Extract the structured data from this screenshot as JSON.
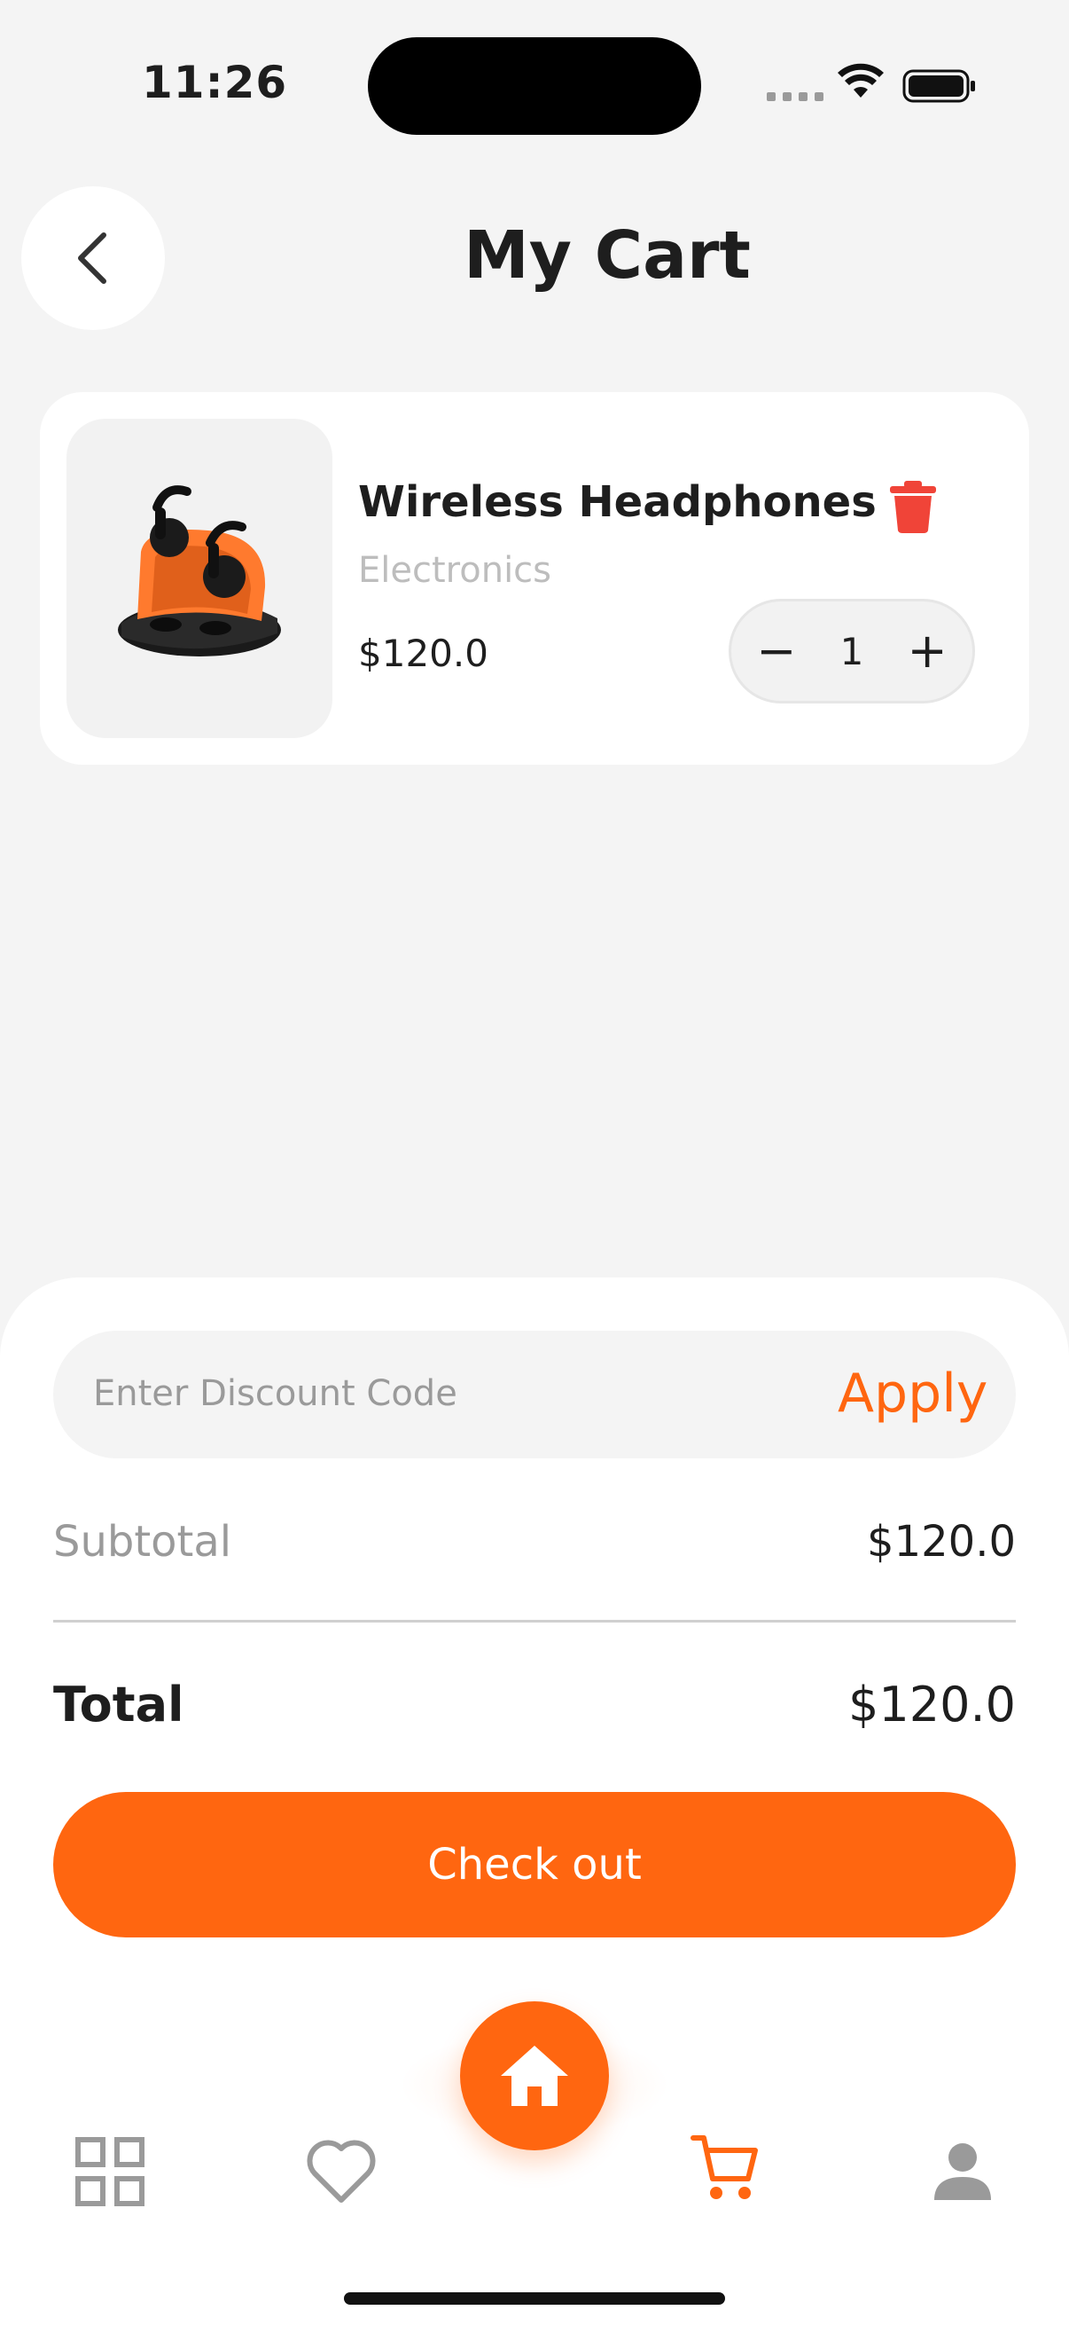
{
  "status_bar": {
    "time": "11:26"
  },
  "header": {
    "title": "My Cart"
  },
  "cart": {
    "items": [
      {
        "name": "Wireless Headphones",
        "category": "Electronics",
        "price": "$120.0",
        "quantity": "1"
      }
    ]
  },
  "discount": {
    "placeholder": "Enter Discount Code",
    "apply_label": "Apply"
  },
  "summary": {
    "subtotal_label": "Subtotal",
    "subtotal_value": "$120.0",
    "total_label": "Total",
    "total_value": "$120.0"
  },
  "checkout_label": "Check out",
  "nav": {
    "items": [
      {
        "icon": "grid-icon"
      },
      {
        "icon": "heart-icon"
      },
      {
        "icon": "home-icon"
      },
      {
        "icon": "cart-icon",
        "active": true
      },
      {
        "icon": "profile-icon"
      }
    ]
  },
  "colors": {
    "accent": "#FF6610",
    "background": "#F4F4F4",
    "delete": "#F04438",
    "muted": "#9A9A9A"
  }
}
